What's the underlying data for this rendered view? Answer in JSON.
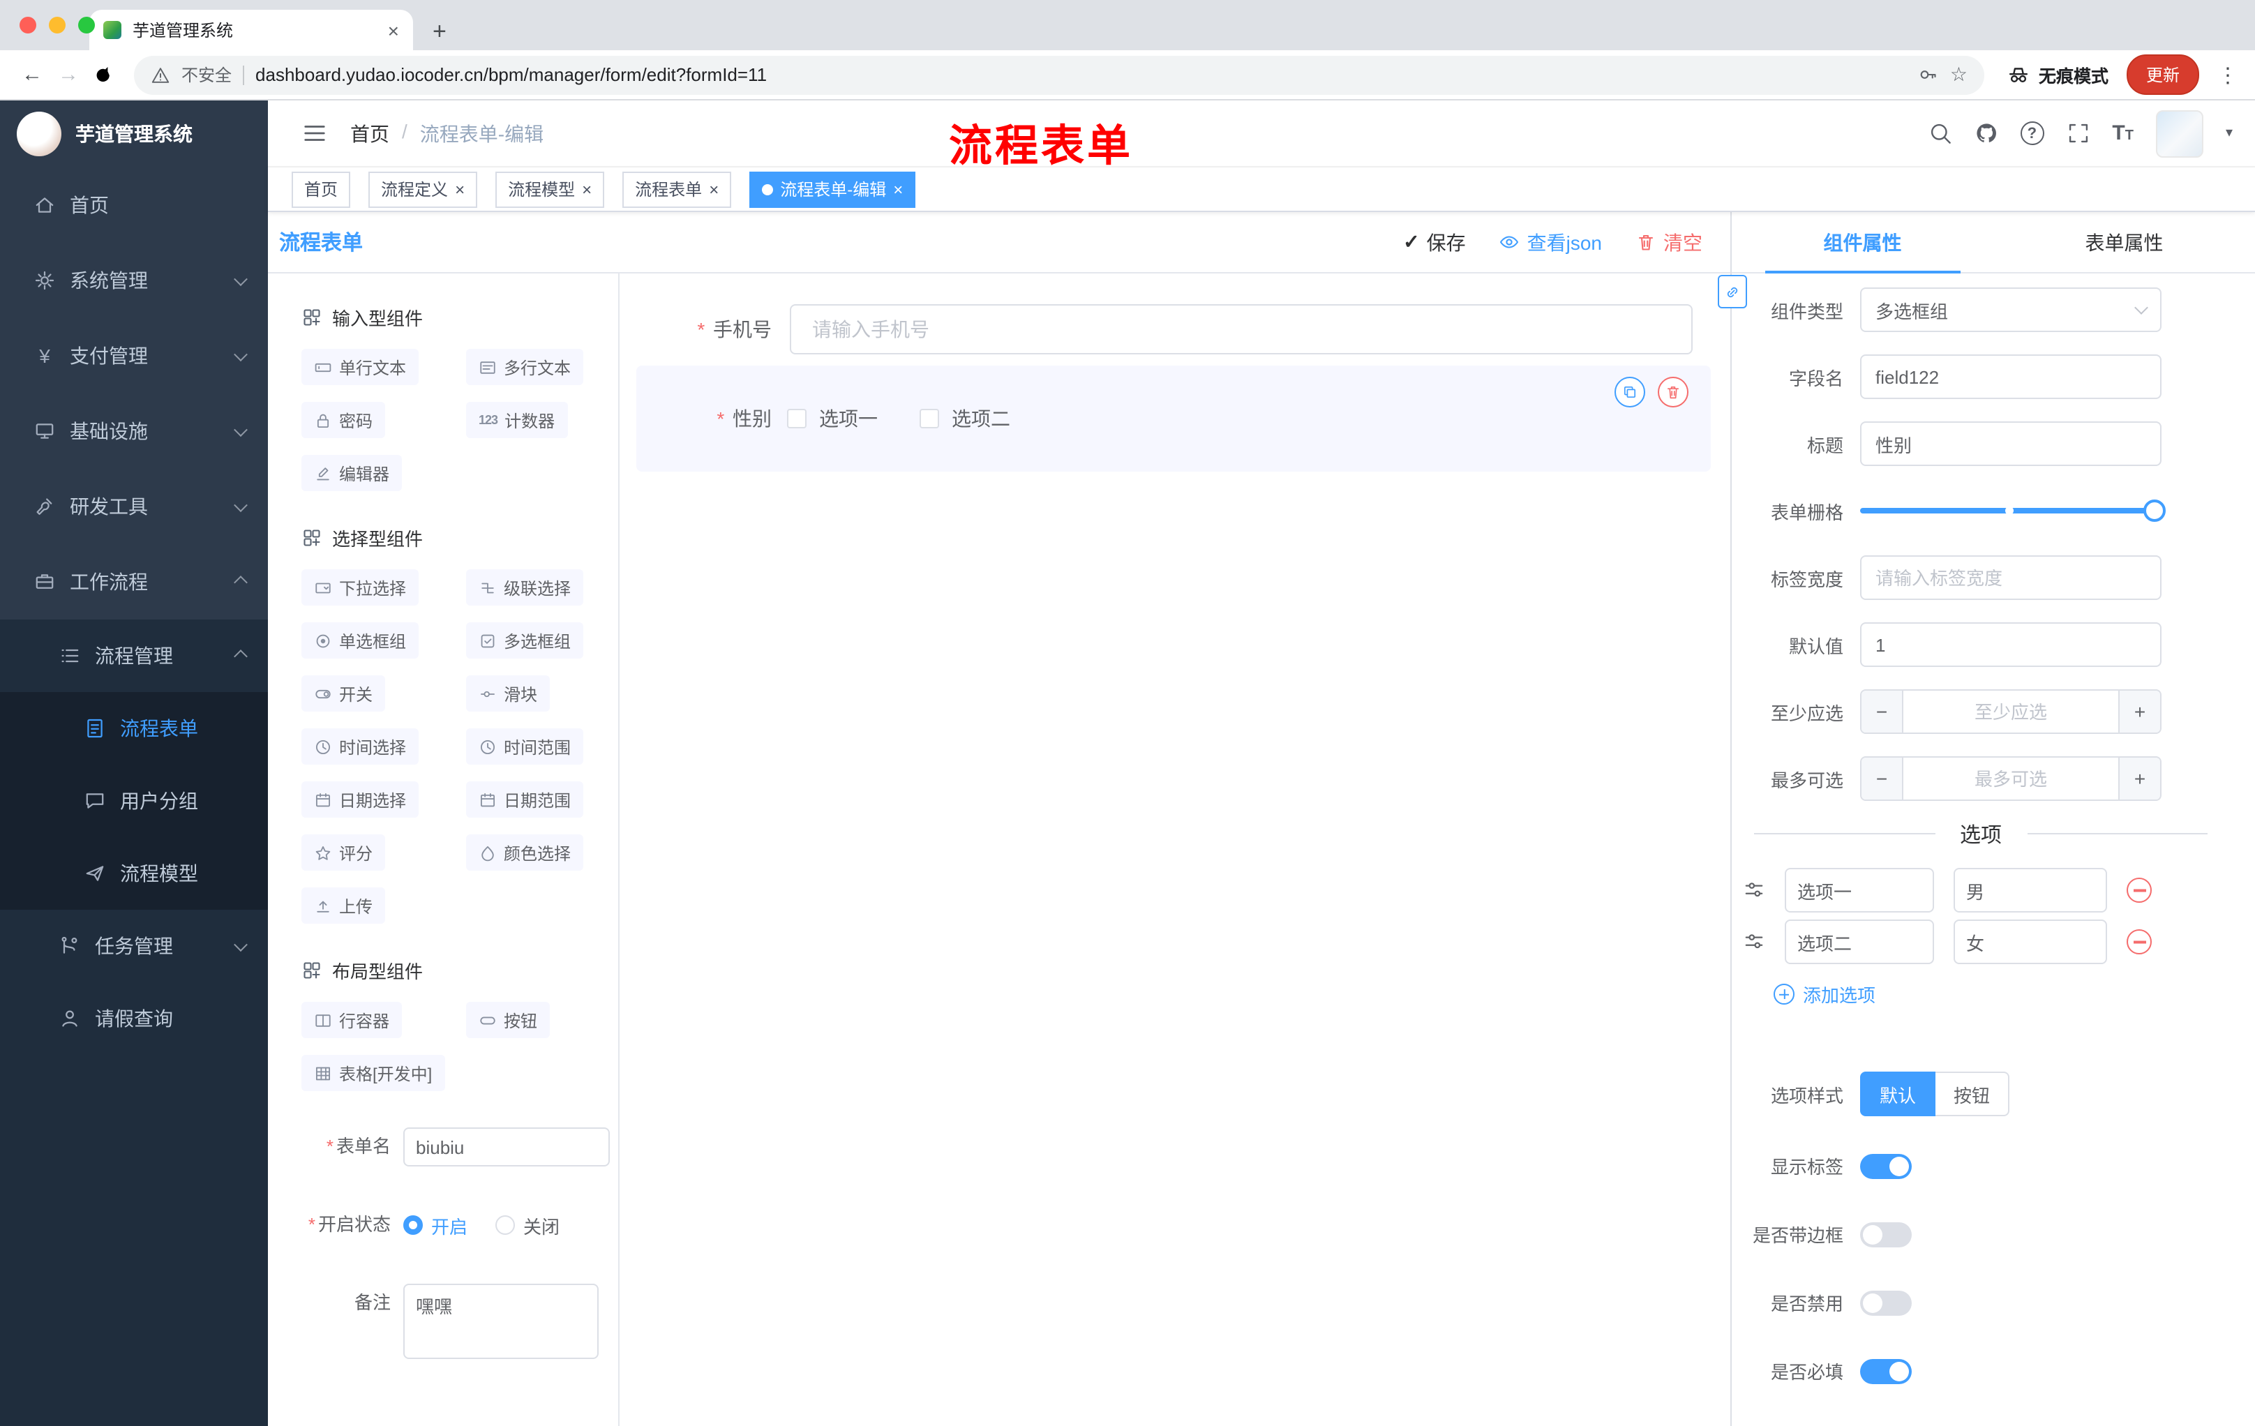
{
  "colors": {
    "primary": "#409eff",
    "danger": "#f56c6c",
    "annotation_red": "#ff0000",
    "update_button": "#d73c2d",
    "sidebar_bg": "#2d3a4b",
    "active_tag_bg": "#409eff"
  },
  "glyphs": {
    "close": "×",
    "back": "←",
    "forward": "→",
    "star": "☆",
    "kebab": "⋮",
    "plus": "+",
    "minus": "−",
    "check": "✓",
    "question": "?",
    "caret_down": "▾",
    "required": "*",
    "letter_t": "T",
    "yen": "¥"
  },
  "browser": {
    "tab_title": "芋道管理系统",
    "security_label": "不安全",
    "url": "dashboard.yudao.iocoder.cn/bpm/manager/form/edit?formId=11",
    "incognito_label": "无痕模式",
    "update_label": "更新"
  },
  "sidebar": {
    "logo_title": "芋道管理系统",
    "menu": [
      {
        "label": "首页"
      },
      {
        "label": "系统管理"
      },
      {
        "label": "支付管理"
      },
      {
        "label": "基础设施"
      },
      {
        "label": "研发工具"
      },
      {
        "label": "工作流程"
      },
      {
        "label": "流程管理"
      },
      {
        "label": "流程表单"
      },
      {
        "label": "用户分组"
      },
      {
        "label": "流程模型"
      },
      {
        "label": "任务管理"
      },
      {
        "label": "请假查询"
      }
    ]
  },
  "header": {
    "breadcrumb_home": "首页",
    "breadcrumb_separator": "/",
    "breadcrumb_current": "流程表单-编辑",
    "annotation": "流程表单"
  },
  "tags": [
    {
      "label": "首页"
    },
    {
      "label": "流程定义"
    },
    {
      "label": "流程模型"
    },
    {
      "label": "流程表单"
    },
    {
      "label": "流程表单-编辑"
    }
  ],
  "designer": {
    "title": "流程表单",
    "save": "保存",
    "view_json": "查看json",
    "clear": "清空",
    "groups": [
      {
        "title": "输入型组件"
      },
      {
        "title": "选择型组件"
      },
      {
        "title": "布局型组件"
      }
    ],
    "chips": {
      "single_text": "单行文本",
      "multi_text": "多行文本",
      "password": "密码",
      "counter": "计数器",
      "counter_icon": "123",
      "editor": "编辑器",
      "select": "下拉选择",
      "cascader": "级联选择",
      "radio_group": "单选框组",
      "checkbox_group": "多选框组",
      "switch": "开关",
      "slider": "滑块",
      "time": "时间选择",
      "time_range": "时间范围",
      "date": "日期选择",
      "date_range": "日期范围",
      "rate": "评分",
      "color": "颜色选择",
      "upload": "上传",
      "row": "行容器",
      "button": "按钮",
      "table": "表格[开发中]"
    },
    "meta": {
      "form_name_label": "表单名",
      "form_name_value": "biubiu",
      "status_label": "开启状态",
      "status_on": "开启",
      "status_off": "关闭",
      "remark_label": "备注",
      "remark_value": "嘿嘿"
    },
    "canvas": {
      "phone_label": "手机号",
      "phone_placeholder": "请输入手机号",
      "gender_label": "性别",
      "option1": "选项一",
      "option2": "选项二"
    }
  },
  "props": {
    "tab_component": "组件属性",
    "tab_form": "表单属性",
    "component_type_label": "组件类型",
    "component_type_value": "多选框组",
    "field_name_label": "字段名",
    "field_name_value": "field122",
    "title_label": "标题",
    "title_value": "性别",
    "grid_label": "表单栅格",
    "label_width_label": "标签宽度",
    "label_width_placeholder": "请输入标签宽度",
    "default_label": "默认值",
    "default_value": "1",
    "min_label": "至少应选",
    "min_placeholder": "至少应选",
    "max_label": "最多可选",
    "max_placeholder": "最多可选",
    "options_title": "选项",
    "options": [
      {
        "label": "选项一",
        "value": "男"
      },
      {
        "label": "选项二",
        "value": "女"
      }
    ],
    "add_option": "添加选项",
    "style_label": "选项样式",
    "style_default": "默认",
    "style_button": "按钮",
    "show_label": "显示标签",
    "bordered_label": "是否带边框",
    "disabled_label": "是否禁用",
    "required_label": "是否必填"
  }
}
